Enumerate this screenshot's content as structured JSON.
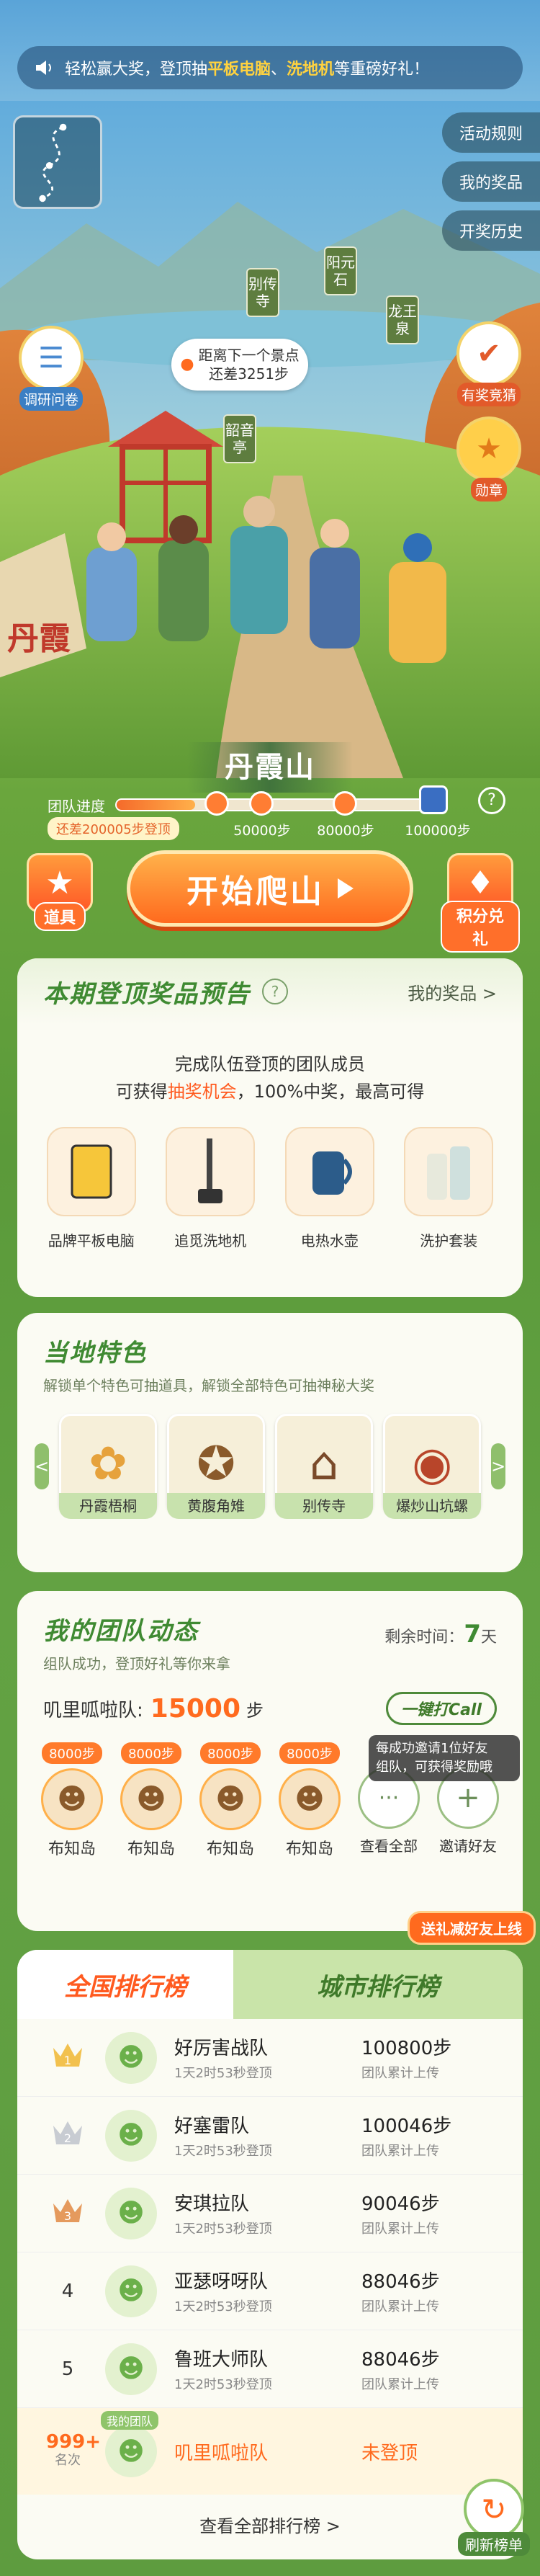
{
  "notice": {
    "prefix": "轻松赢大奖，登顶抽",
    "hl1": "平板电脑",
    "sep": "、",
    "hl2": "洗地机",
    "suffix": "等重磅好礼！"
  },
  "right_menu": [
    "活动规则",
    "我的奖品",
    "开奖历史"
  ],
  "scene": {
    "signs": [
      "别传寺",
      "阳元石",
      "龙王泉",
      "韶音亭"
    ],
    "bubble_line1": "距离下一个景点",
    "bubble_line2": "还差3251步",
    "survey_label": "调研问卷",
    "quiz_label": "有奖竞猜",
    "medal_label": "勋章",
    "rock_text": "丹霞"
  },
  "mountain": {
    "name": "丹霞山",
    "progress_label": "团队进度",
    "steps_badge": "还差200005步登顶",
    "nodes": [
      "50000步",
      "80000步",
      "100000步"
    ],
    "progress_fraction": 0.25,
    "help_icon_text": "?"
  },
  "actions": {
    "props_label": "道具",
    "start_label": "开始爬山",
    "exchange_label": "积分兑礼"
  },
  "prizes": {
    "title": "本期登顶奖品预告",
    "help_icon_text": "?",
    "link": "我的奖品 >",
    "desc_line1": "完成队伍登顶的团队成员",
    "desc_line2_prefix": "可获得",
    "desc_line2_hl": "抽奖机会",
    "desc_line2_suffix": "，100%中奖，最高可得",
    "items": [
      "品牌平板电脑",
      "追觅洗地机",
      "电热水壶",
      "洗护套装"
    ]
  },
  "features": {
    "title": "当地特色",
    "subtitle": "解锁单个特色可抽道具，解锁全部特色可抽神秘大奖",
    "items": [
      "丹霞梧桐",
      "黄腹角雉",
      "别传寺",
      "爆炒山坑螺"
    ],
    "prev": "<",
    "next": ">"
  },
  "team": {
    "title": "我的团队动态",
    "subtitle": "组队成功，登顶好礼等你来拿",
    "remain_label": "剩余时间：",
    "remain_value": "7",
    "remain_unit": "天",
    "team_label": "叽里呱啦队:",
    "team_steps": "15000",
    "team_unit": "步",
    "call_button": "一键打Call",
    "tooltip_line1": "每成功邀请1位好友",
    "tooltip_line2": "组队，可获得奖励哦",
    "members": [
      {
        "steps": "8000步",
        "name": "布知岛"
      },
      {
        "steps": "8000步",
        "name": "布知岛"
      },
      {
        "steps": "8000步",
        "name": "布知岛"
      },
      {
        "steps": "8000步",
        "name": "布知岛"
      }
    ],
    "view_all": "查看全部",
    "invite": "邀请好友",
    "invite_banner": "送礼减好友上线",
    "more_dots": "···",
    "plus": "+"
  },
  "rank": {
    "tab_national": "全国排行榜",
    "tab_city": "城市排行榜",
    "rows": [
      {
        "no": "1",
        "name": "好厉害战队",
        "time": "1天2时53秒登顶",
        "steps": "100800步",
        "note": "团队累计上传"
      },
      {
        "no": "2",
        "name": "好塞雷队",
        "time": "1天2时53秒登顶",
        "steps": "100046步",
        "note": "团队累计上传"
      },
      {
        "no": "3",
        "name": "安琪拉队",
        "time": "1天2时53秒登顶",
        "steps": "90046步",
        "note": "团队累计上传"
      },
      {
        "no": "4",
        "name": "亚瑟呀呀队",
        "time": "1天2时53秒登顶",
        "steps": "88046步",
        "note": "团队累计上传"
      },
      {
        "no": "5",
        "name": "鲁班大师队",
        "time": "1天2时53秒登顶",
        "steps": "88046步",
        "note": "团队累计上传"
      }
    ],
    "my_rank": "999+",
    "my_rank_label": "名次",
    "my_team_tag": "我的团队",
    "my_team_name": "叽里呱啦队",
    "my_status": "未登顶",
    "view_all": "查看全部排行榜 >",
    "refresh": "刷新榜单"
  },
  "colors": {
    "accent_orange": "#ff6a1e",
    "brand_green": "#3f8a32",
    "gold": "#f2c14e",
    "silver": "#c8ccd2",
    "bronze": "#e59a5d"
  }
}
